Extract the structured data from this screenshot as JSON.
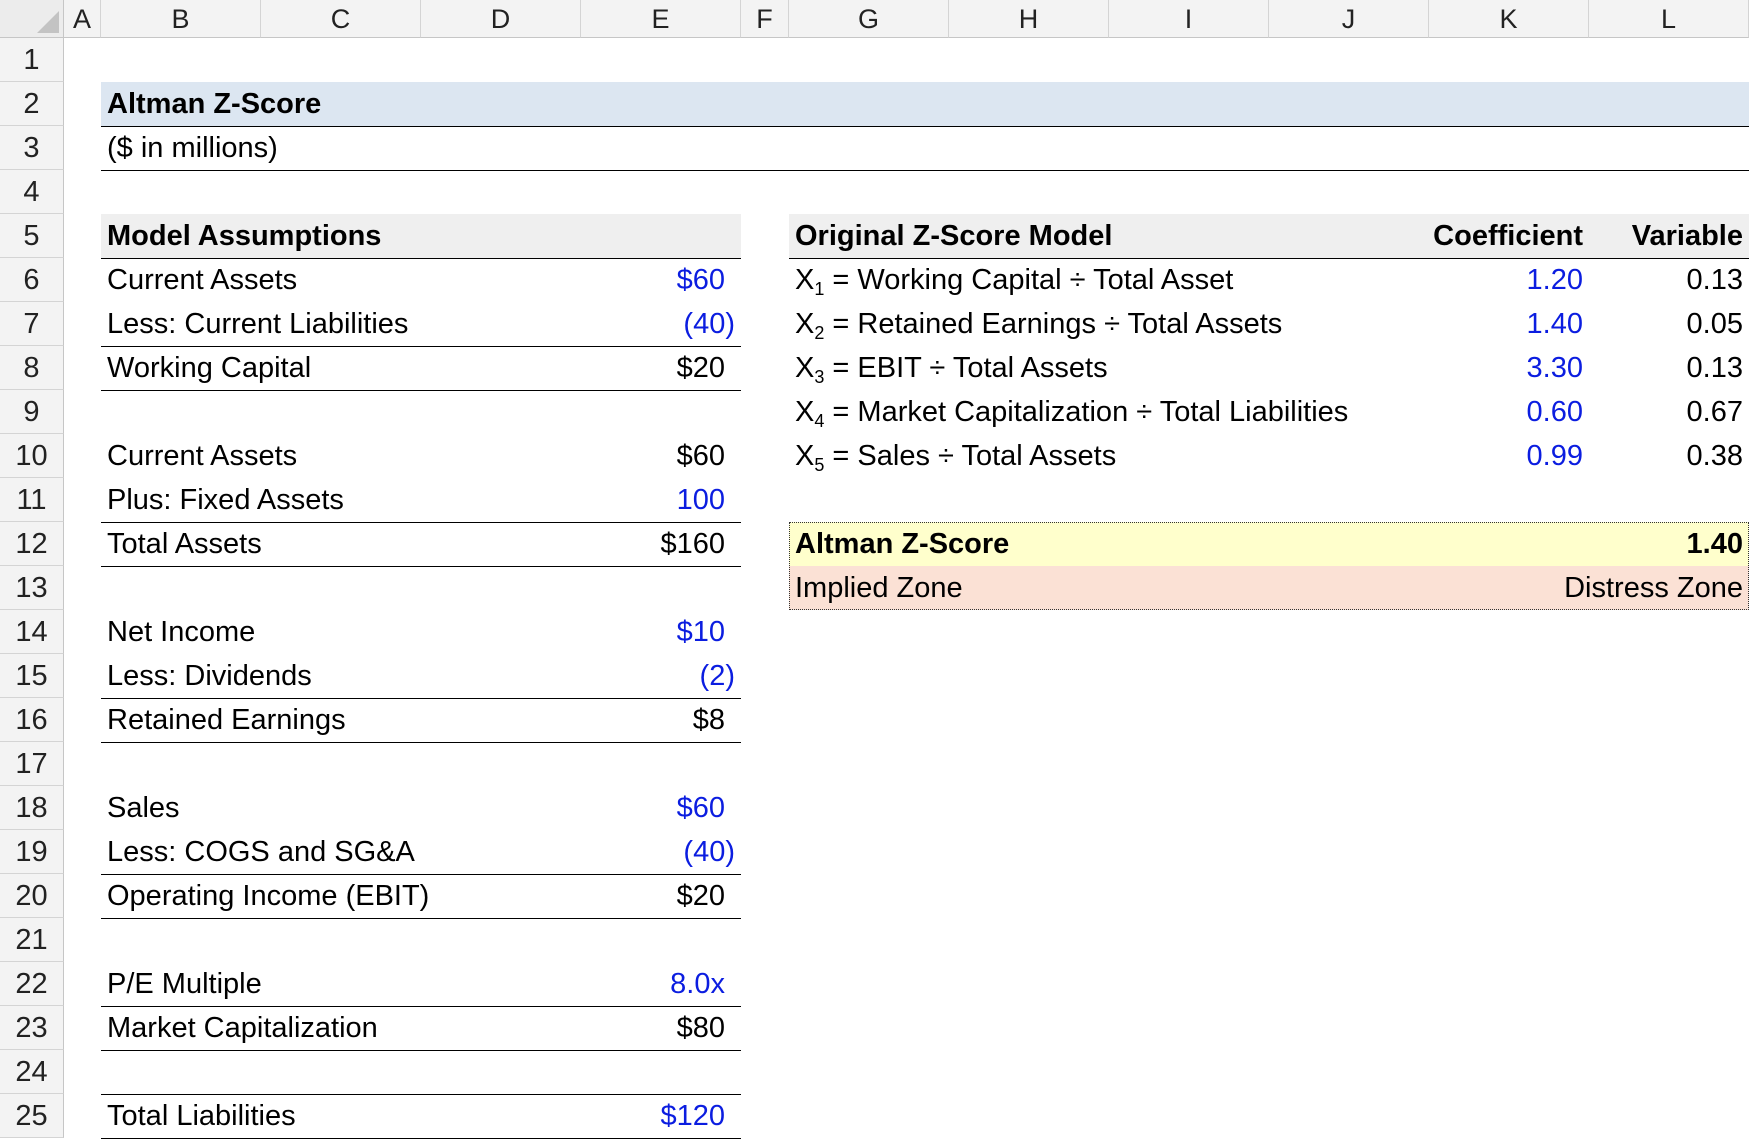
{
  "columns": [
    "A",
    "B",
    "C",
    "D",
    "E",
    "F",
    "G",
    "H",
    "I",
    "J",
    "K",
    "L"
  ],
  "rows": [
    "1",
    "2",
    "3",
    "4",
    "5",
    "6",
    "7",
    "8",
    "9",
    "10",
    "11",
    "12",
    "13",
    "14",
    "15",
    "16",
    "17",
    "18",
    "19",
    "20",
    "21",
    "22",
    "23",
    "24",
    "25"
  ],
  "title": "Altman Z-Score",
  "subtitle": "($ in millions)",
  "assumptions": {
    "header": "Model Assumptions",
    "items": [
      {
        "label": "Current Assets",
        "value": "$60"
      },
      {
        "label": "Less: Current Liabilities",
        "value": "(40)"
      },
      {
        "label": "Working Capital",
        "value": "$20"
      },
      {
        "label": "Current Assets",
        "value": "$60"
      },
      {
        "label": "Plus: Fixed Assets",
        "value": "100"
      },
      {
        "label": "Total Assets",
        "value": "$160"
      },
      {
        "label": "Net Income",
        "value": "$10"
      },
      {
        "label": "Less: Dividends",
        "value": "(2)"
      },
      {
        "label": "Retained Earnings",
        "value": "$8"
      },
      {
        "label": "Sales",
        "value": "$60"
      },
      {
        "label": "Less: COGS and SG&A",
        "value": "(40)"
      },
      {
        "label": "Operating Income (EBIT)",
        "value": "$20"
      },
      {
        "label": "P/E Multiple",
        "value": "8.0x"
      },
      {
        "label": "Market Capitalization",
        "value": "$80"
      },
      {
        "label": "Total Liabilities",
        "value": "$120"
      }
    ]
  },
  "model": {
    "header": "Original Z-Score Model",
    "coef_header": "Coefficient",
    "var_header": "Variable",
    "rows": [
      {
        "var": "X",
        "sub": "1",
        "formula": " = Working Capital ÷ Total Asset",
        "coefficient": "1.20",
        "variable": "0.13"
      },
      {
        "var": "X",
        "sub": "2",
        "formula": " = Retained Earnings ÷ Total Assets",
        "coefficient": "1.40",
        "variable": "0.05"
      },
      {
        "var": "X",
        "sub": "3",
        "formula": " = EBIT ÷ Total Assets",
        "coefficient": "3.30",
        "variable": "0.13"
      },
      {
        "var": "X",
        "sub": "4",
        "formula": " = Market Capitalization ÷ Total Liabilities",
        "coefficient": "0.60",
        "variable": "0.67"
      },
      {
        "var": "X",
        "sub": "5",
        "formula": " = Sales ÷ Total Assets",
        "coefficient": "0.99",
        "variable": "0.38"
      }
    ]
  },
  "result": {
    "score_label": "Altman Z-Score",
    "score_value": "1.40",
    "zone_label": "Implied Zone",
    "zone_value": "Distress Zone"
  },
  "colors": {
    "input_blue": "#0b1de0",
    "title_band": "#dce6f1",
    "header_band": "#efefef",
    "score_band": "#ffffcc",
    "zone_band": "#fbe1d5"
  }
}
